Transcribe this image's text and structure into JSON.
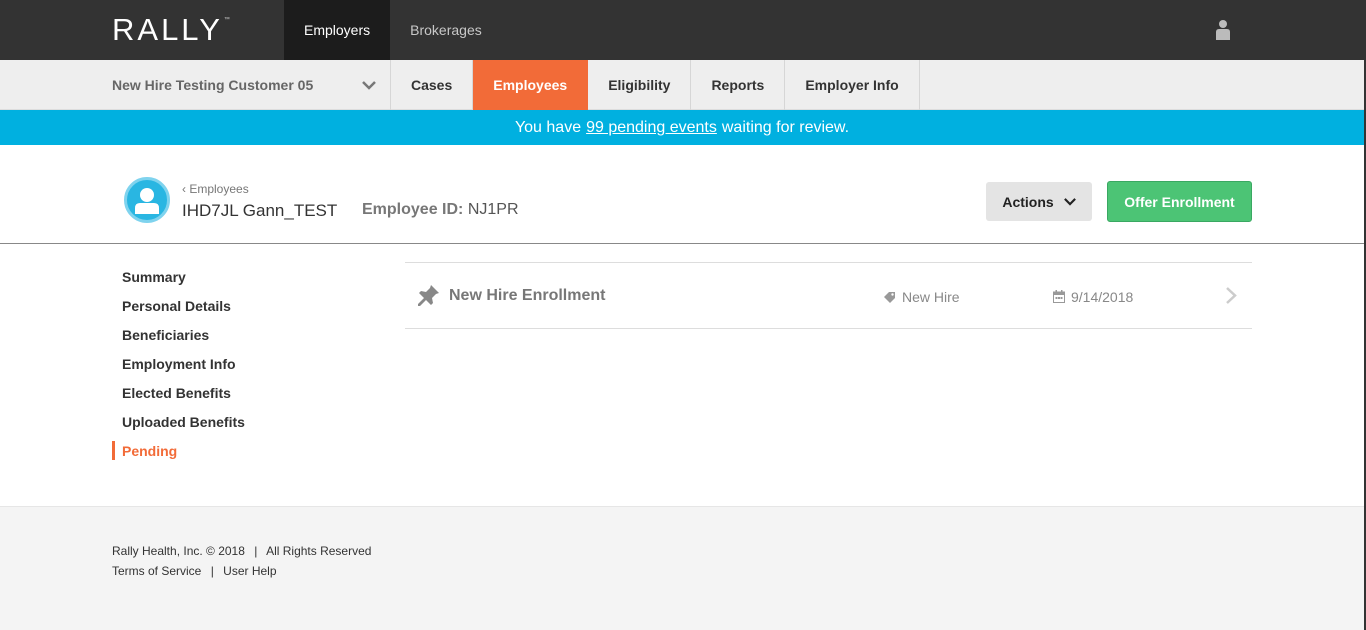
{
  "header": {
    "logo_text": "RALLY",
    "logo_tm": "™",
    "nav": [
      {
        "label": "Employers",
        "active": true
      },
      {
        "label": "Brokerages",
        "active": false
      }
    ],
    "user_icon": "person-icon"
  },
  "subnav": {
    "customer_name": "New Hire Testing Customer 05",
    "tabs": [
      {
        "label": "Cases"
      },
      {
        "label": "Employees",
        "active": true
      },
      {
        "label": "Eligibility"
      },
      {
        "label": "Reports"
      },
      {
        "label": "Employer Info"
      }
    ]
  },
  "banner": {
    "prefix": "You have",
    "link": "99 pending events",
    "suffix": "waiting for review."
  },
  "employee": {
    "back_label": "Employees",
    "name": "IHD7JL Gann_TEST",
    "id_label": "Employee ID:",
    "id_value": "NJ1PR",
    "actions_label": "Actions",
    "offer_label": "Offer Enrollment"
  },
  "sidebar": {
    "items": [
      {
        "label": "Summary"
      },
      {
        "label": "Personal Details"
      },
      {
        "label": "Beneficiaries"
      },
      {
        "label": "Employment Info"
      },
      {
        "label": "Elected Benefits"
      },
      {
        "label": "Uploaded Benefits"
      },
      {
        "label": "Pending",
        "active": true
      }
    ]
  },
  "pending": {
    "title": "New Hire Enrollment",
    "type": "New Hire",
    "date": "9/14/2018"
  },
  "footer": {
    "copyright": "Rally Health, Inc. © 2018",
    "rights": "All Rights Reserved",
    "terms": "Terms of Service",
    "help": "User Help",
    "separator": "|"
  },
  "colors": {
    "accent": "#f26b38",
    "banner": "#00b0e0",
    "success": "#4cc475",
    "topbar": "#333333"
  }
}
